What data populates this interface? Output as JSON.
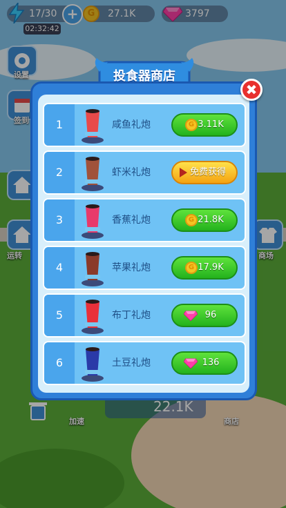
{
  "hud": {
    "energy": "17/30",
    "timer": "02:32:42",
    "coins": "27.1K",
    "gems": "3797",
    "coin_symbol": "G"
  },
  "side": {
    "settings_label": "设置",
    "signin_label": "签到",
    "left_label": "运转",
    "right_label": "商场"
  },
  "shop": {
    "title": "投食器商店",
    "close_symbol": "✖",
    "items": [
      {
        "index": "1",
        "name": "咸鱼礼炮",
        "price": "3.11K",
        "currency": "coin",
        "color": "#e84a4a"
      },
      {
        "index": "2",
        "name": "虾米礼炮",
        "price": "免费获得",
        "currency": "free",
        "color": "#a0523a"
      },
      {
        "index": "3",
        "name": "香蕉礼炮",
        "price": "21.8K",
        "currency": "coin",
        "color": "#e83a6a"
      },
      {
        "index": "4",
        "name": "苹果礼炮",
        "price": "17.9K",
        "currency": "coin",
        "color": "#8a3a2a"
      },
      {
        "index": "5",
        "name": "布丁礼炮",
        "price": "96",
        "currency": "gem",
        "color": "#e8303a"
      },
      {
        "index": "6",
        "name": "土豆礼炮",
        "price": "136",
        "currency": "gem",
        "color": "#2a3aa8"
      }
    ]
  },
  "bottom": {
    "left_label": "加速",
    "center_coins": "22.1K",
    "right_label": "商店"
  }
}
